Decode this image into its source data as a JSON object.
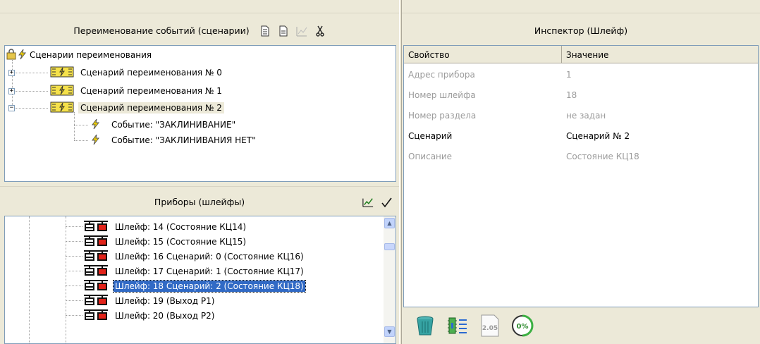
{
  "scenarios_panel": {
    "title": "Переименование событий (сценарии)",
    "toolbar_icons": [
      "document-add-icon",
      "document-icon",
      "chart-edit-icon",
      "cut-icon"
    ],
    "tree": {
      "root": "Сценарии переименования",
      "items": [
        {
          "label": "Сценарий переименования № 0",
          "expander": "+"
        },
        {
          "label": "Сценарий переименования № 1",
          "expander": "+"
        },
        {
          "label": "Сценарий переименования № 2",
          "expander": "−",
          "children": [
            "Событие: \"ЗАКЛИНИВАНИЕ\"",
            "Событие: \"ЗАКЛИНИВАНИЯ НЕТ\""
          ]
        }
      ]
    }
  },
  "devices_panel": {
    "title": "Приборы (шлейфы)",
    "toolbar_icons": [
      "chart-edit-icon",
      "checkmark-icon"
    ],
    "items": [
      "Шлейф: 14 (Состояние КЦ14)",
      "Шлейф: 15 (Состояние КЦ15)",
      "Шлейф: 16 Сценарий: 0 (Состояние КЦ16)",
      "Шлейф: 17 Сценарий: 1 (Состояние КЦ17)",
      "Шлейф: 18 Сценарий: 2 (Состояние КЦ18)",
      "Шлейф: 19 (Выход Р1)",
      "Шлейф: 20 (Выход Р2)"
    ],
    "selected_index": 4
  },
  "inspector": {
    "title": "Инспектор (Шлейф)",
    "columns": [
      "Свойство",
      "Значение"
    ],
    "rows": [
      {
        "property": "Адрес прибора",
        "value": "1",
        "enabled": false
      },
      {
        "property": "Номер шлейфа",
        "value": "18",
        "enabled": false
      },
      {
        "property": "Номер раздела",
        "value": "не задан",
        "enabled": false
      },
      {
        "property": "Сценарий",
        "value": "Сценарий № 2",
        "enabled": true
      },
      {
        "property": "Описание",
        "value": "Состояние КЦ18",
        "enabled": false
      }
    ],
    "bottom_icons": [
      "recycle-bin-icon",
      "device-config-icon",
      "version-icon",
      "progress-icon"
    ],
    "version_label": "2.05",
    "progress_label": "0%"
  },
  "colors": {
    "window_bg": "#ece9d8",
    "selection": "#316ac5",
    "border": "#7f9db9",
    "disabled_text": "#9b9b9b"
  }
}
